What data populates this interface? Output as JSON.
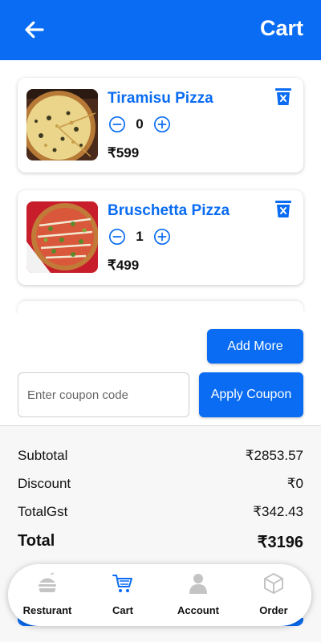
{
  "header": {
    "title": "Cart",
    "back_icon": "arrow-left-icon"
  },
  "cart": {
    "items": [
      {
        "name": "Tiramisu Pizza",
        "quantity": "0",
        "price": "₹599"
      },
      {
        "name": "Bruschetta Pizza",
        "quantity": "1",
        "price": "₹499"
      }
    ]
  },
  "actions": {
    "add_more": "Add More",
    "coupon_placeholder": "Enter coupon code",
    "apply_coupon": "Apply Coupon"
  },
  "summary": {
    "subtotal_label": "Subtotal",
    "subtotal": "₹2853.57",
    "discount_label": "Discount",
    "discount": "₹0",
    "gst_label": "TotalGst",
    "gst": "₹342.43",
    "total_label": "Total",
    "total": "₹3196"
  },
  "nav": {
    "items": [
      {
        "label": "Resturant",
        "icon": "burger-icon",
        "active": false
      },
      {
        "label": "Cart",
        "icon": "cart-icon",
        "active": true
      },
      {
        "label": "Account",
        "icon": "person-icon",
        "active": false
      },
      {
        "label": "Order",
        "icon": "box-icon",
        "active": false
      }
    ]
  },
  "colors": {
    "primary": "#0a6cf2",
    "text": "#111111",
    "muted_icon": "#c4c4c4"
  }
}
